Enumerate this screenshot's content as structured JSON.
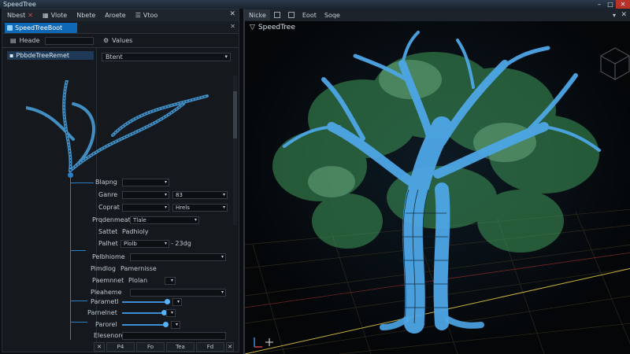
{
  "window": {
    "title": "SpeedTree"
  },
  "left_panel": {
    "menu": [
      {
        "label": "Nbest"
      },
      {
        "label": "Vlote"
      },
      {
        "label": "Nbete"
      },
      {
        "label": "Aroete"
      },
      {
        "label": "Vtoo"
      }
    ],
    "active_tab": "SpeedTreeBoot",
    "hierarchy_label": "Heade",
    "values_label": "Values",
    "tree_item": "PbbdeTreeRemet",
    "stat_select": "Btent"
  },
  "properties": {
    "rows": [
      {
        "label": "Blapng",
        "field": ""
      },
      {
        "label": "Ganre",
        "field": "",
        "field2": "83"
      },
      {
        "label": "Coprat",
        "field": "",
        "field2": "Hrels"
      },
      {
        "label": "Prqdenmeat",
        "field": "Tlale"
      },
      {
        "label": "Sattet",
        "field": "Padhioly"
      },
      {
        "label": "Palhet",
        "field": "Plolb",
        "field2": "- 23dg"
      },
      {
        "label": "Pelbhiome",
        "field": ""
      },
      {
        "label": "Pimdlog",
        "field": "Pamernisse"
      },
      {
        "label": "Paemnnet",
        "field": "Plolan"
      },
      {
        "label": "Pleaheme",
        "field": ""
      },
      {
        "label": "Parametl",
        "field": ""
      },
      {
        "label": "Parnelnet",
        "field": ""
      },
      {
        "label": "Parorel",
        "field": ""
      },
      {
        "label": "Elesenore",
        "field": ""
      }
    ],
    "bottom_buttons": [
      "P4",
      "Fo",
      "Tea",
      "Fd"
    ]
  },
  "viewport": {
    "tabs": [
      {
        "label": "Nicke"
      },
      {
        "label": ""
      },
      {
        "label": "Eoot"
      },
      {
        "label": "Soqe"
      }
    ],
    "label": "SpeedTree"
  },
  "colors": {
    "accent": "#0f68b6",
    "wire": "#4da6e6",
    "leaf": "#3f9a5a"
  }
}
